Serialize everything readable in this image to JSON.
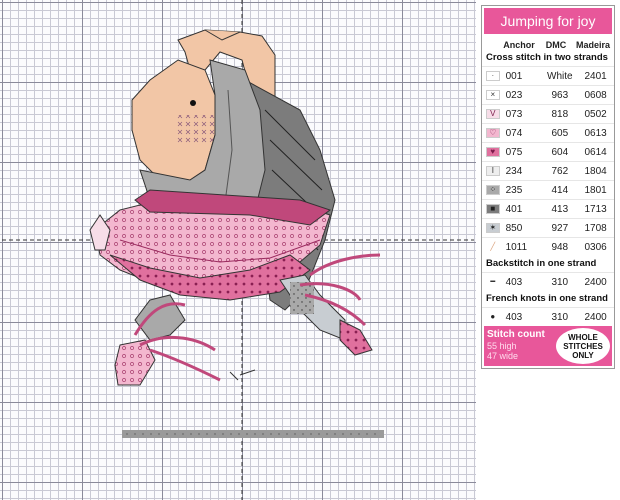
{
  "key": {
    "title": "Jumping for joy",
    "columns": {
      "anchor": "Anchor",
      "dmc": "DMC",
      "madeira": "Madeira"
    },
    "cross_heading": "Cross stitch in two strands",
    "cross_rows": [
      {
        "symbol": "·",
        "anchor": "001",
        "dmc": "White",
        "madeira": "2401",
        "bg": "#ffffff",
        "fg": "#555555"
      },
      {
        "symbol": "×",
        "anchor": "023",
        "dmc": "963",
        "madeira": "0608",
        "bg": "#ffffff",
        "fg": "#333333"
      },
      {
        "symbol": "V",
        "anchor": "073",
        "dmc": "818",
        "madeira": "0502",
        "bg": "#f7dde8",
        "fg": "#7a1a4a"
      },
      {
        "symbol": "♡",
        "anchor": "074",
        "dmc": "605",
        "madeira": "0613",
        "bg": "#f3b7cf",
        "fg": "#7a1a4a"
      },
      {
        "symbol": "♥",
        "anchor": "075",
        "dmc": "604",
        "madeira": "0614",
        "bg": "#e0709e",
        "fg": "#7a1a4a"
      },
      {
        "symbol": "I",
        "anchor": "234",
        "dmc": "762",
        "madeira": "1804",
        "bg": "#eeeeee",
        "fg": "#333333"
      },
      {
        "symbol": "⁘",
        "anchor": "235",
        "dmc": "414",
        "madeira": "1801",
        "bg": "#a9a9a9",
        "fg": "#222222"
      },
      {
        "symbol": "■",
        "anchor": "401",
        "dmc": "413",
        "madeira": "1713",
        "bg": "#7c7c7c",
        "fg": "#222222"
      },
      {
        "symbol": "✶",
        "anchor": "850",
        "dmc": "927",
        "madeira": "1708",
        "bg": "#c8cdd2",
        "fg": "#222222"
      },
      {
        "symbol": "╱",
        "anchor": "1011",
        "dmc": "948",
        "madeira": "0306",
        "bg": "#ffffff",
        "fg": "#d9a07a"
      }
    ],
    "backstitch_heading": "Backstitch in one strand",
    "backstitch_row": {
      "symbol": "━",
      "anchor": "403",
      "dmc": "310",
      "madeira": "2400"
    },
    "french_heading": "French knots in one strand",
    "french_row": {
      "symbol": "●",
      "anchor": "403",
      "dmc": "310",
      "madeira": "2400"
    },
    "stitch_count": {
      "title": "Stitch count",
      "high": "55 high",
      "wide": "47 wide"
    },
    "badge": {
      "line1": "WHOLE",
      "line2": "STITCHES",
      "line3": "ONLY"
    }
  },
  "colors": {
    "accent": "#e8579a",
    "skin": "#f2c6a6",
    "pink_light": "#f3b7cf",
    "pink_mid": "#e0709e",
    "pink_dark": "#c0487b",
    "grey": "#a9a9a9",
    "grey_dark": "#6e6e6e",
    "blue_grey": "#c8cdd2",
    "ground": "#9a9a9a"
  }
}
